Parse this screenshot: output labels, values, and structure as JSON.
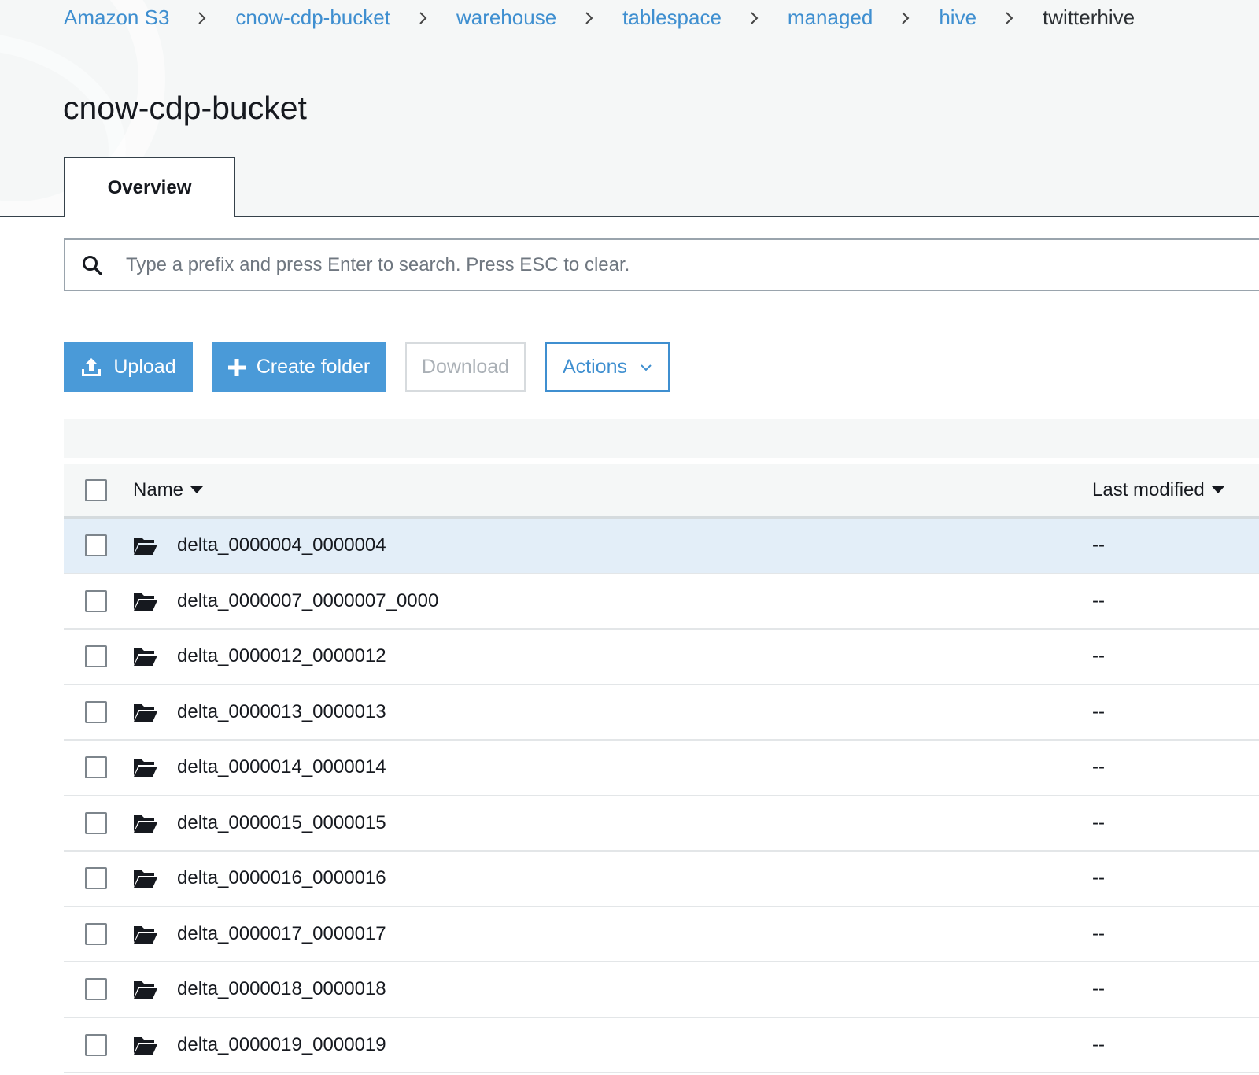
{
  "breadcrumb": [
    {
      "label": "Amazon S3",
      "link": true
    },
    {
      "label": "cnow-cdp-bucket",
      "link": true
    },
    {
      "label": "warehouse",
      "link": true
    },
    {
      "label": "tablespace",
      "link": true
    },
    {
      "label": "managed",
      "link": true
    },
    {
      "label": "hive",
      "link": true
    },
    {
      "label": "twitterhive",
      "link": false
    }
  ],
  "page": {
    "title": "cnow-cdp-bucket"
  },
  "tabs": [
    {
      "label": "Overview",
      "active": true
    }
  ],
  "search": {
    "placeholder": "Type a prefix and press Enter to search. Press ESC to clear.",
    "value": ""
  },
  "toolbar": {
    "upload_label": "Upload",
    "create_folder_label": "Create folder",
    "download_label": "Download",
    "actions_label": "Actions"
  },
  "table": {
    "columns": {
      "name": "Name",
      "last_modified": "Last modified"
    },
    "rows": [
      {
        "name": "delta_0000004_0000004",
        "last_modified": "--",
        "selected": true
      },
      {
        "name": "delta_0000007_0000007_0000",
        "last_modified": "--",
        "selected": false
      },
      {
        "name": "delta_0000012_0000012",
        "last_modified": "--",
        "selected": false
      },
      {
        "name": "delta_0000013_0000013",
        "last_modified": "--",
        "selected": false
      },
      {
        "name": "delta_0000014_0000014",
        "last_modified": "--",
        "selected": false
      },
      {
        "name": "delta_0000015_0000015",
        "last_modified": "--",
        "selected": false
      },
      {
        "name": "delta_0000016_0000016",
        "last_modified": "--",
        "selected": false
      },
      {
        "name": "delta_0000017_0000017",
        "last_modified": "--",
        "selected": false
      },
      {
        "name": "delta_0000018_0000018",
        "last_modified": "--",
        "selected": false
      },
      {
        "name": "delta_0000019_0000019",
        "last_modified": "--",
        "selected": false
      }
    ]
  },
  "icons": {
    "search": "search-icon",
    "upload": "upload-icon",
    "create_folder": "plus-icon",
    "actions": "chevron-down-icon",
    "sort": "caret-down-icon",
    "folder": "folder-open-icon"
  },
  "colors": {
    "link": "#3f8fd0",
    "primary_button": "#4a9ad8",
    "selected_row": "#e3eef8",
    "header_band": "#f5f7f7"
  }
}
